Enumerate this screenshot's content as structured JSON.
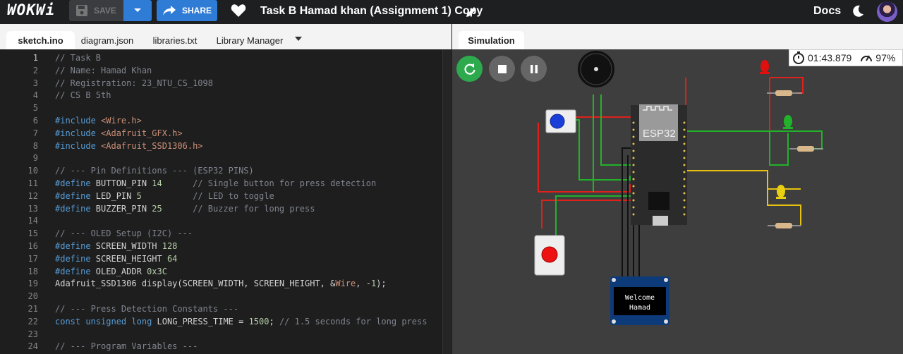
{
  "header": {
    "logo": "WOKWi",
    "save_label": "SAVE",
    "share_label": "SHARE",
    "project_title": "Task B Hamad khan (Assignment 1) Copy",
    "docs_label": "Docs"
  },
  "editor": {
    "tabs": [
      "sketch.ino",
      "diagram.json",
      "libraries.txt",
      "Library Manager"
    ],
    "active_tab": "sketch.ino",
    "current_line": 1,
    "lines": [
      "// Task B",
      "// Name: Hamad Khan",
      "// Registration: 23_NTU_CS_1098",
      "// CS B 5th",
      "",
      "#include <Wire.h>",
      "#include <Adafruit_GFX.h>",
      "#include <Adafruit_SSD1306.h>",
      "",
      "// --- Pin Definitions --- (ESP32 PINS)",
      "#define BUTTON_PIN 14      // Single button for press detection",
      "#define LED_PIN 5          // LED to toggle",
      "#define BUZZER_PIN 25      // Buzzer for long press",
      "",
      "// --- OLED Setup (I2C) ---",
      "#define SCREEN_WIDTH 128",
      "#define SCREEN_HEIGHT 64",
      "#define OLED_ADDR 0x3C",
      "Adafruit_SSD1306 display(SCREEN_WIDTH, SCREEN_HEIGHT, &Wire, -1);",
      "",
      "// --- Press Detection Constants ---",
      "const unsigned long LONG_PRESS_TIME = 1500; // 1.5 seconds for long press",
      "",
      "// --- Program Variables ---"
    ]
  },
  "simulation": {
    "tab_label": "Simulation",
    "timer": "01:43.879",
    "speed": "97%",
    "esp32_label": "ESP32",
    "oled_text": [
      "Welcome",
      "Hamad"
    ],
    "colors": {
      "restart": "#2eaa4e",
      "stop": "#666666",
      "pause": "#666666"
    }
  }
}
